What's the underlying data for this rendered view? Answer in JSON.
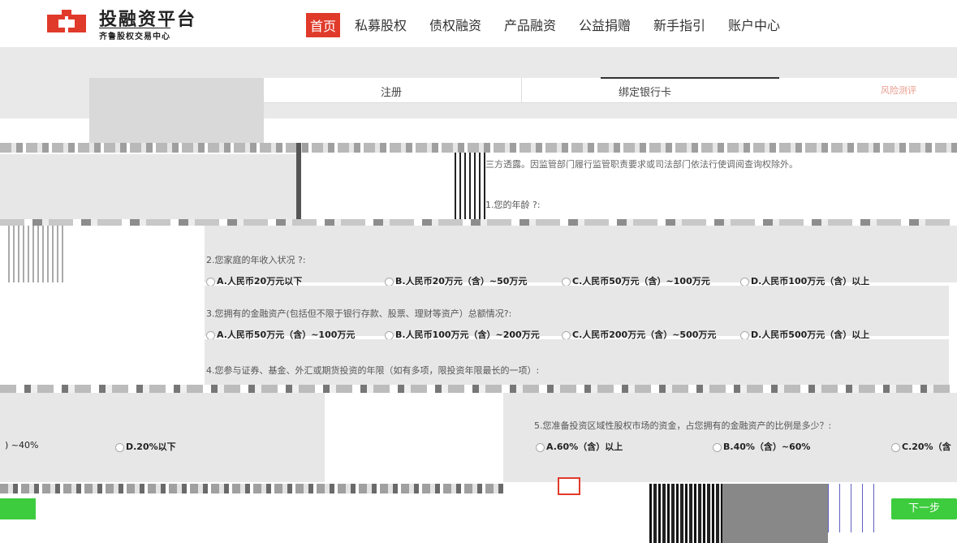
{
  "brand": {
    "title": "投融资平台",
    "subtitle": "齐鲁股权交易中心",
    "colors": {
      "accent": "#e03a2a",
      "green": "#3dcc3d"
    }
  },
  "nav": {
    "items": [
      {
        "label": "首页",
        "active": true
      },
      {
        "label": "私募股权"
      },
      {
        "label": "债权融资"
      },
      {
        "label": "产品融资"
      },
      {
        "label": "公益捐赠"
      },
      {
        "label": "新手指引"
      },
      {
        "label": "账户中心"
      }
    ]
  },
  "steps": {
    "register": "注册",
    "bind_card": "绑定银行卡",
    "risk": "风险测评"
  },
  "notice": {
    "line2": "三方透露。因监管部门履行监管职责要求或司法部门依法行使调阅查询权除外。"
  },
  "q1": {
    "title": "1.您的年龄 ?:"
  },
  "q2": {
    "title": "2.您家庭的年收入状况 ?:",
    "options": [
      "A.人民币20万元以下",
      "B.人民币20万元（含）~50万元",
      "C.人民币50万元（含）~100万元",
      "D.人民币100万元（含）以上"
    ]
  },
  "q3": {
    "title": "3.您拥有的金融资产(包括但不限于银行存款、股票、理财等资产）总额情况?:",
    "options": [
      "A.人民币50万元（含）~100万元",
      "B.人民币100万元（含）~200万元",
      "C.人民币200万元（含）~500万元",
      "D.人民币500万元（含）以上"
    ]
  },
  "q4": {
    "title": "4.您参与证券、基金、外汇或期货投资的年限（如有多项，限投资年限最长的一项）:"
  },
  "q5": {
    "title": "5.您准备投资区域性股权市场的资金，占您拥有的金融资产的比例是多少？:",
    "options": [
      "A.60%（含）以上",
      "B.40%（含）~60%",
      "C.20%（含"
    ],
    "left_fragment": ") ~40%",
    "left_option_d": "D.20%以下"
  },
  "buttons": {
    "next": "下一步"
  }
}
